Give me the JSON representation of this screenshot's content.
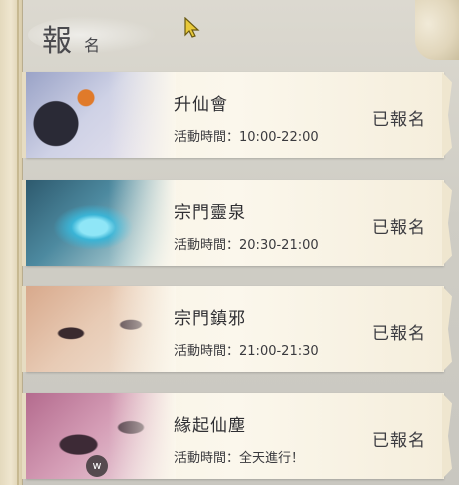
{
  "header": {
    "title_main": "報",
    "title_sub": "名"
  },
  "events": [
    {
      "name": "升仙會",
      "time_label": "活動時間：",
      "time": "10:00-22:00",
      "status": "已報名"
    },
    {
      "name": "宗門靈泉",
      "time_label": "活動時間：",
      "time": "20:30-21:00",
      "status": "已報名"
    },
    {
      "name": "宗門鎮邪",
      "time_label": "活動時間：",
      "time": "21:00-21:30",
      "status": "已報名"
    },
    {
      "name": "緣起仙塵",
      "time_label": "活動時間：",
      "time": "全天進行！",
      "status": "已報名"
    }
  ],
  "watermark": {
    "label": "w"
  }
}
